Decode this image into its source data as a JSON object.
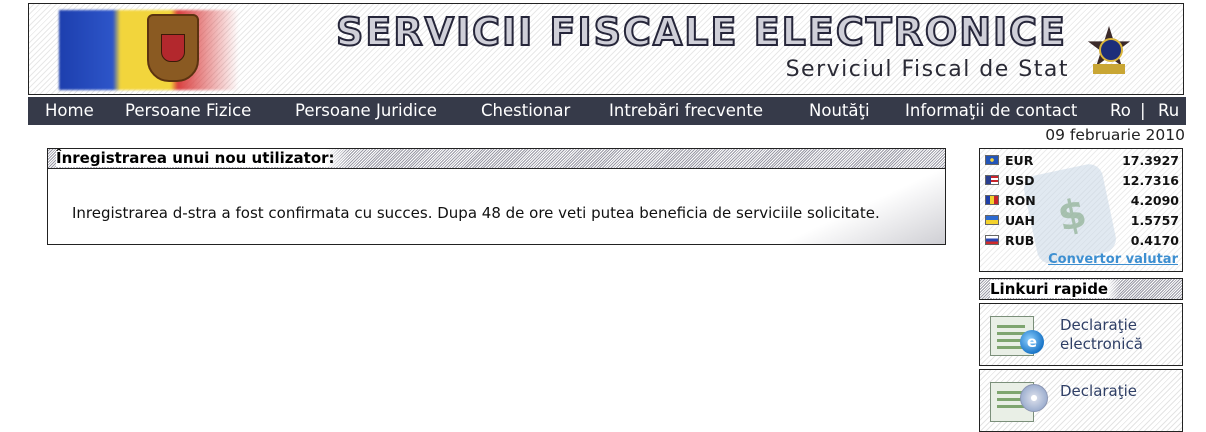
{
  "banner": {
    "title": "SERVICII FISCALE ELECTRONICE",
    "subtitle": "Serviciul Fiscal de Stat"
  },
  "nav": {
    "items": [
      "Home",
      "Persoane Fizice",
      "Persoane Juridice",
      "Chestionar",
      "Intrebări frecvente",
      "Noutăţi",
      "Informaţii de contact"
    ],
    "lang_ro": "Ro",
    "lang_sep": "|",
    "lang_ru": "Ru"
  },
  "date": "09 februarie 2010",
  "panel": {
    "title": "Înregistrarea unui nou utilizator:",
    "message": "Inregistrarea d-stra a fost confirmata cu succes. Dupa 48 de ore veti putea beneficia de serviciile solicitate."
  },
  "rates": {
    "rows": [
      {
        "code": "EUR",
        "value": "17.3927"
      },
      {
        "code": "USD",
        "value": "12.7316"
      },
      {
        "code": "RON",
        "value": "4.2090"
      },
      {
        "code": "UAH",
        "value": "1.5757"
      },
      {
        "code": "RUB",
        "value": "0.4170"
      }
    ],
    "converter_link": "Convertor valutar"
  },
  "quick_links": {
    "title": "Linkuri rapide",
    "items": [
      {
        "line1": "Declaraţie",
        "line2": "electronică"
      },
      {
        "line1": "Declaraţie",
        "line2": ""
      }
    ]
  }
}
